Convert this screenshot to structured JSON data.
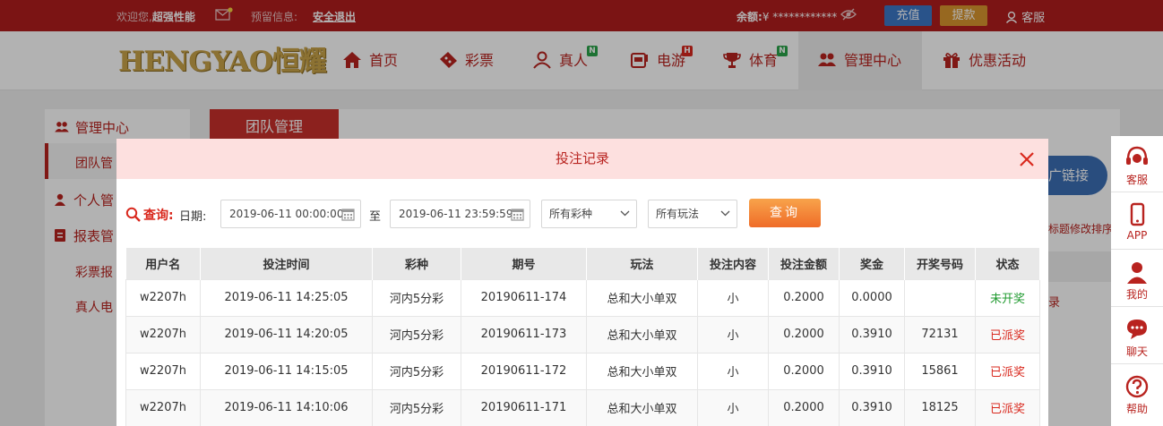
{
  "topbar": {
    "welcome": "欢迎您,",
    "username": "超强性能",
    "notice_label": "预留信息:",
    "logout": "安全退出",
    "balance_label": "余额:",
    "balance_value": "¥ ************",
    "recharge": "充值",
    "withdraw": "提款",
    "service": "客服"
  },
  "nav": {
    "logo": "HENGYAO恒耀",
    "items": [
      {
        "label": "首页"
      },
      {
        "label": "彩票"
      },
      {
        "label": "真人",
        "badge": "N"
      },
      {
        "label": "电游",
        "badge": "H"
      },
      {
        "label": "体育",
        "badge": "N"
      },
      {
        "label": "管理中心"
      },
      {
        "label": "优惠活动"
      }
    ]
  },
  "sidebar": {
    "header": "管理中心",
    "team": "团队管",
    "personal": "个人管",
    "report": "报表管",
    "lottery_report": "彩票报",
    "live_report": "真人电"
  },
  "panel": {
    "tab": "团队管理",
    "promo": "广链接",
    "note": "标题修改排序",
    "link": "录"
  },
  "rightbar": [
    "客服",
    "APP",
    "我的",
    "聊天",
    "帮助"
  ],
  "modal": {
    "title": "投注记录",
    "query_label": "查询:",
    "date_label": "日期:",
    "start_date": "2019-06-11 00:00:00",
    "to_label": "至",
    "end_date": "2019-06-11 23:59:59",
    "lottery_select": "所有彩种",
    "play_select": "所有玩法",
    "query_button": "查询",
    "columns": [
      "用户名",
      "投注时间",
      "彩种",
      "期号",
      "玩法",
      "投注内容",
      "投注金额",
      "奖金",
      "开奖号码",
      "状态"
    ],
    "rows": [
      [
        "w2207h",
        "2019-06-11 14:25:05",
        "河内5分彩",
        "20190611-174",
        "总和大小单双",
        "小",
        "0.2000",
        "0.0000",
        "",
        "未开奖"
      ],
      [
        "w2207h",
        "2019-06-11 14:20:05",
        "河内5分彩",
        "20190611-173",
        "总和大小单双",
        "小",
        "0.2000",
        "0.3910",
        "72131",
        "已派奖"
      ],
      [
        "w2207h",
        "2019-06-11 14:15:05",
        "河内5分彩",
        "20190611-172",
        "总和大小单双",
        "小",
        "0.2000",
        "0.3910",
        "15861",
        "已派奖"
      ],
      [
        "w2207h",
        "2019-06-11 14:10:06",
        "河内5分彩",
        "20190611-171",
        "总和大小单双",
        "小",
        "0.2000",
        "0.3910",
        "18125",
        "已派奖"
      ]
    ]
  },
  "colors": {
    "brand_red": "#b01e1e",
    "accent_red": "#d9281d",
    "status_pending": "#1f9a2f",
    "status_paid": "#d9281d"
  }
}
